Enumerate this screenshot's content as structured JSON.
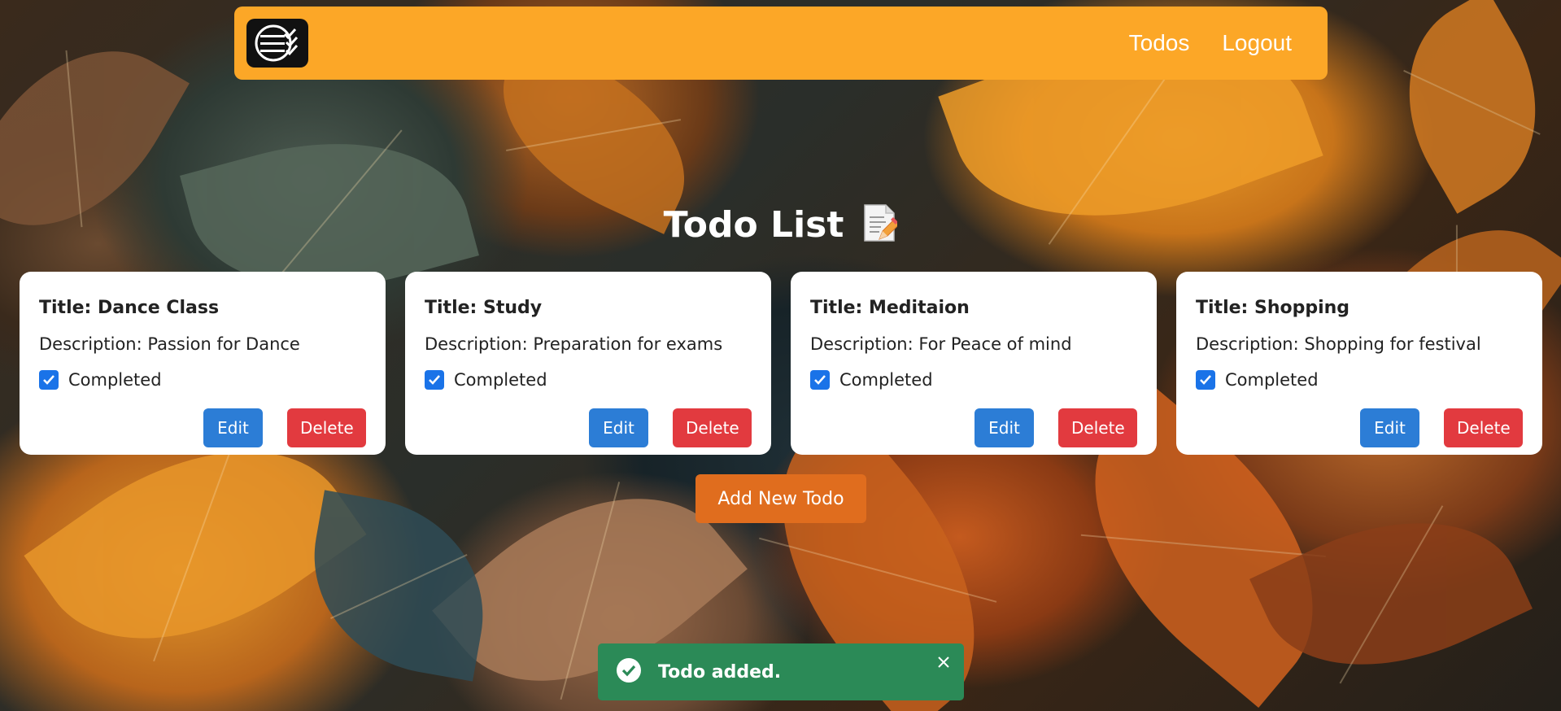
{
  "navbar": {
    "logo_icon": "checklist-logo-icon",
    "links": [
      {
        "label": "Todos"
      },
      {
        "label": "Logout"
      }
    ],
    "color": "#fca727"
  },
  "page": {
    "title": "Todo List",
    "title_icon": "memo-icon"
  },
  "todos": [
    {
      "title": "Title: Dance Class",
      "description": "Description: Passion for Dance",
      "status": "Completed",
      "edit_label": "Edit",
      "delete_label": "Delete"
    },
    {
      "title": "Title: Study",
      "description": "Description: Preparation for exams",
      "status": "Completed",
      "edit_label": "Edit",
      "delete_label": "Delete"
    },
    {
      "title": "Title: Meditaion",
      "description": "Description: For Peace of mind",
      "status": "Completed",
      "edit_label": "Edit",
      "delete_label": "Delete"
    },
    {
      "title": "Title: Shopping",
      "description": "Description: Shopping for festival",
      "status": "Completed",
      "edit_label": "Edit",
      "delete_label": "Delete"
    }
  ],
  "add_button": {
    "label": "Add New Todo",
    "color": "#e06d1e"
  },
  "toast": {
    "message": "Todo added.",
    "icon": "check-circle-icon",
    "close_icon": "close-icon",
    "color": "#2b8a57"
  }
}
